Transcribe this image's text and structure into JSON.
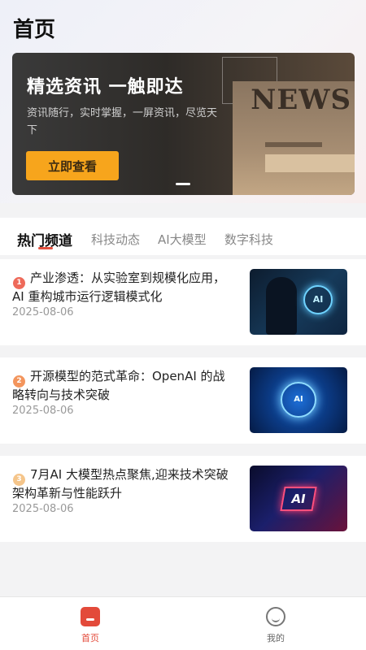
{
  "header": {
    "title": "首页"
  },
  "banner": {
    "headline": "精选资讯 一触即达",
    "subtitle": "资讯随行，实时掌握，一屏资讯，尽览天下",
    "button_label": "立即查看",
    "image_text": "NEWS"
  },
  "tabs": [
    {
      "label": "热门频道",
      "active": true
    },
    {
      "label": "科技动态",
      "active": false
    },
    {
      "label": "AI大模型",
      "active": false
    },
    {
      "label": "数字科技",
      "active": false
    }
  ],
  "news": [
    {
      "rank": "1",
      "title": "产业渗透：从实验室到规模化应用，AI 重构城市运行逻辑模式化",
      "date": "2025-08-06",
      "image_text": "AI"
    },
    {
      "rank": "2",
      "title": "开源模型的范式革命：OpenAI 的战略转向与技术突破",
      "date": "2025-08-06",
      "image_text": "AI"
    },
    {
      "rank": "3",
      "title": "7月AI 大模型热点聚焦,迎来技术突破架构革新与性能跃升",
      "date": "2025-08-06",
      "image_text": "AI"
    }
  ],
  "bottom_nav": [
    {
      "label": "首页",
      "icon": "home-icon",
      "active": true
    },
    {
      "label": "我的",
      "icon": "profile-icon",
      "active": false
    }
  ],
  "colors": {
    "accent": "#e34a3a",
    "banner_button": "#f7a51c"
  }
}
